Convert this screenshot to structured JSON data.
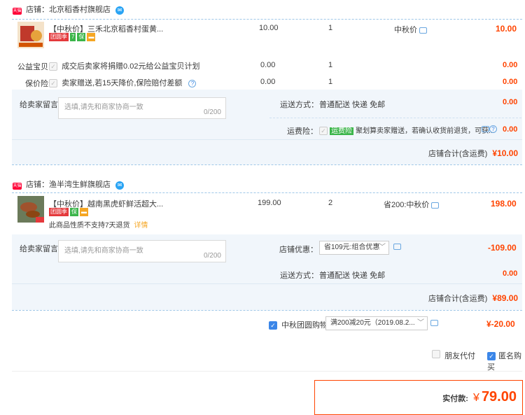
{
  "shop1": {
    "label": "店铺：北京稻香村旗舰店",
    "item": {
      "title": "【中秋价】三禾北京稻香村蛋黄...",
      "price": "10.00",
      "qty": "1",
      "discount": "中秋价",
      "total": "10.00",
      "tags": [
        "团圆季",
        "7",
        "保",
        "▬"
      ]
    },
    "charity": {
      "label": "公益宝贝",
      "text": "成交后卖家将捐赠0.02元给公益宝贝计划",
      "price": "0.00",
      "qty": "1",
      "total": "0.00"
    },
    "insurance": {
      "label": "保价险",
      "text": "卖家赠送,若15天降价,保险赔付差额",
      "price": "0.00",
      "qty": "1",
      "total": "0.00"
    },
    "message_label": "给卖家留言：",
    "message_placeholder": "选填,请先和商家协商一致",
    "message_count": "0/200",
    "shipping_label": "运送方式：",
    "shipping_value": "普通配送 快递 免邮",
    "shipping_total": "0.00",
    "freight_label": "运费险：",
    "freight_tag": "运费险",
    "freight_text": "聚划算卖家赠送，若确认收货前退货，可获...",
    "freight_total": "0.00",
    "subtotal_label": "店铺合计(含运费)",
    "subtotal_value": "¥10.00"
  },
  "shop2": {
    "label": "店铺：渔半湾生鲜旗舰店",
    "item": {
      "title": "【中秋价】越南黑虎虾鲜活超大...",
      "price": "199.00",
      "qty": "2",
      "discount": "省200:中秋价",
      "total": "198.00",
      "return_note": "此商品性质不支持7天退货",
      "return_link": "详情",
      "tags": [
        "团圆季",
        "保",
        "▬"
      ]
    },
    "message_label": "给卖家留言：",
    "message_placeholder": "选填,请先和商家协商一致",
    "message_count": "0/200",
    "coupon_label": "店铺优惠：",
    "coupon_value": "省109元:组合优惠",
    "coupon_total": "-109.00",
    "shipping_label": "运送方式：",
    "shipping_value": "普通配送 快递 免邮",
    "shipping_total": "0.00",
    "subtotal_label": "店铺合计(含运费)",
    "subtotal_value": "¥89.00"
  },
  "platform_coupon": {
    "label": "中秋团圆购物券",
    "value": "满200减20元（2019.08.2...",
    "total": "¥-20.00"
  },
  "options": {
    "friend_pay": "朋友代付",
    "anonymous": "匿名购买"
  },
  "payment": {
    "label": "实付款:",
    "currency": "¥",
    "amount": "79.00"
  }
}
